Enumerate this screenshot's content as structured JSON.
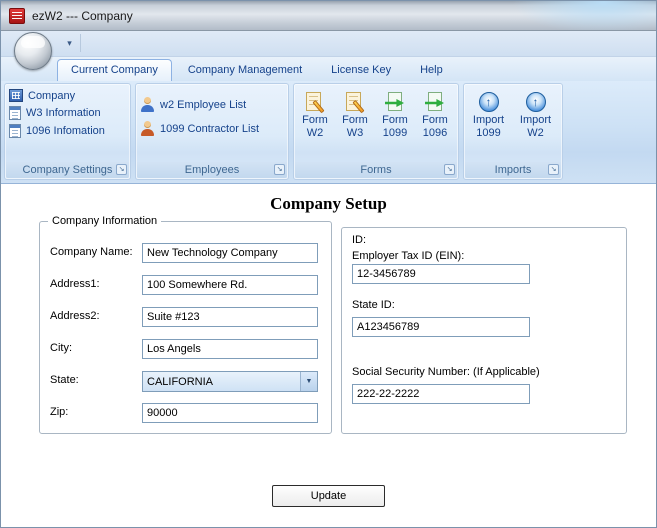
{
  "window": {
    "title": "ezW2 --- Company"
  },
  "icons": {
    "qat_dropdown": "▾",
    "combo_arrow": "▼",
    "launcher": "↘",
    "import_arrow": "↑"
  },
  "ribbon": {
    "tabs": [
      {
        "label": "Current Company"
      },
      {
        "label": "Company Management"
      },
      {
        "label": "License Key"
      },
      {
        "label": "Help"
      }
    ],
    "groups": {
      "company_settings": {
        "label": "Company Settings",
        "items": [
          {
            "label": "Company"
          },
          {
            "label": "W3 Information"
          },
          {
            "label": "1096 Infomation"
          }
        ]
      },
      "employees": {
        "label": "Employees",
        "items": [
          {
            "label": "w2 Employee List"
          },
          {
            "label": "1099 Contractor List"
          }
        ]
      },
      "forms": {
        "label": "Forms",
        "items": [
          {
            "line1": "Form",
            "line2": "W2"
          },
          {
            "line1": "Form",
            "line2": "W3"
          },
          {
            "line1": "Form",
            "line2": "1099"
          },
          {
            "line1": "Form",
            "line2": "1096"
          }
        ]
      },
      "imports": {
        "label": "Imports",
        "items": [
          {
            "line1": "Import",
            "line2": "1099"
          },
          {
            "line1": "Import",
            "line2": "W2"
          }
        ]
      }
    }
  },
  "form": {
    "title": "Company Setup",
    "company_info": {
      "legend": "Company Information",
      "fields": [
        {
          "label": "Company Name:",
          "value": "New Technology Company"
        },
        {
          "label": "Address1:",
          "value": "100 Somewhere Rd."
        },
        {
          "label": "Address2:",
          "value": "Suite #123"
        },
        {
          "label": "City:",
          "value": "Los Angels"
        },
        {
          "label": "State:",
          "value": "CALIFORNIA"
        },
        {
          "label": "Zip:",
          "value": "90000"
        }
      ]
    },
    "ids": {
      "heading": "ID:",
      "fields": [
        {
          "label": "Employer Tax ID (EIN):",
          "value": "12-3456789"
        },
        {
          "label": "State ID:",
          "value": "A123456789"
        },
        {
          "label": "Social Security Number: (If Applicable)",
          "value": "222-22-2222"
        }
      ]
    },
    "update_label": "Update"
  }
}
